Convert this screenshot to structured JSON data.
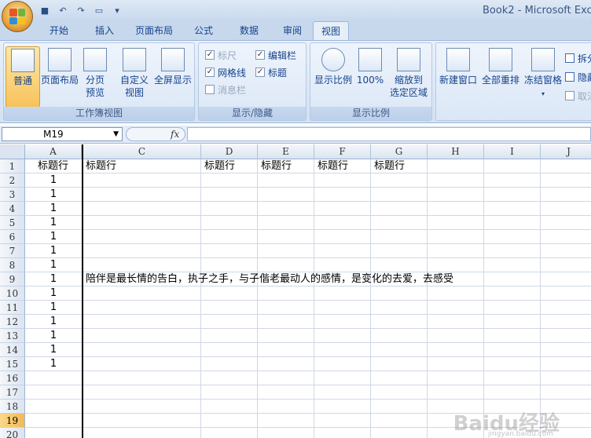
{
  "app": {
    "title": "Book2 - Microsoft Exce",
    "tabs": [
      "开始",
      "插入",
      "页面布局",
      "公式",
      "数据",
      "审阅",
      "视图"
    ],
    "active_tab": "视图"
  },
  "ribbon": {
    "workbook_views": {
      "label": "工作簿视图",
      "normal": "普通",
      "page_layout": "页面布局",
      "page_break_1": "分页",
      "page_break_2": "预览",
      "custom_1": "自定义",
      "custom_2": "视图",
      "fullscreen": "全屏显示"
    },
    "show_hide": {
      "label": "显示/隐藏",
      "ruler": "标尺",
      "formula_bar": "编辑栏",
      "gridlines": "网格线",
      "headings": "标题",
      "message_bar": "消息栏"
    },
    "zoom": {
      "label": "显示比例",
      "zoom": "显示比例",
      "hundred": "100%",
      "to_sel_1": "缩放到",
      "to_sel_2": "选定区域"
    },
    "window": {
      "new_window": "新建窗口",
      "arrange_all": "全部重排",
      "freeze_panes": "冻结窗格",
      "split": "拆分",
      "hide": "隐藏",
      "unhide": "取消"
    }
  },
  "formula_bar": {
    "name_box": "M19",
    "fx": "fx",
    "content": ""
  },
  "sheet": {
    "columns": [
      "A",
      "C",
      "D",
      "E",
      "F",
      "G",
      "H",
      "I",
      "J"
    ],
    "rows": [
      "1",
      "2",
      "3",
      "4",
      "5",
      "6",
      "7",
      "8",
      "9",
      "10",
      "11",
      "12",
      "13",
      "14",
      "15",
      "16",
      "17",
      "18",
      "19",
      "20"
    ],
    "selected_row": "19",
    "row1": {
      "A": "标题行",
      "C": "标题行",
      "D": "标题行",
      "E": "标题行",
      "F": "标题行",
      "G": "标题行"
    },
    "colA_values": [
      "1",
      "1",
      "1",
      "1",
      "1",
      "1",
      "1",
      "1",
      "1",
      "1",
      "1",
      "1",
      "1",
      "1"
    ],
    "row9_text": "陪伴是最长情的告白，执子之手，与子偕老最动人的感情，是变化的去爱，去感受"
  },
  "watermark": {
    "text": "Baidu经验",
    "sub": "jingyan.baidu.com"
  }
}
